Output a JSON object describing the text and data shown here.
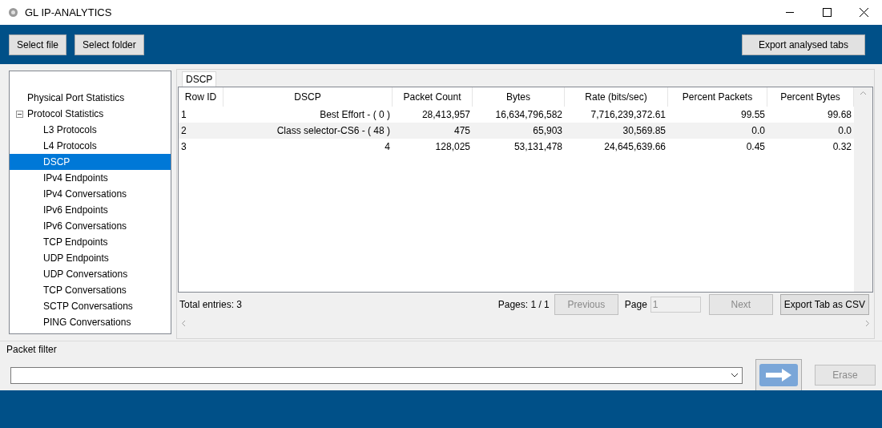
{
  "window": {
    "title": "GL IP-ANALYTICS"
  },
  "toolbar": {
    "left_buttons": [
      "Select file",
      "Select folder"
    ],
    "right_button": "Export analysed tabs"
  },
  "tree": [
    {
      "label": "Physical Port Statistics",
      "selected": false
    },
    {
      "label": "Protocol Statistics",
      "selected": false,
      "expanded": true,
      "children": [
        {
          "label": "L3 Protocols",
          "selected": false
        },
        {
          "label": "L4 Protocols",
          "selected": false
        },
        {
          "label": "DSCP",
          "selected": true
        },
        {
          "label": "IPv4 Endpoints",
          "selected": false
        },
        {
          "label": "IPv4 Conversations",
          "selected": false
        },
        {
          "label": "IPv6 Endpoints",
          "selected": false
        },
        {
          "label": "IPv6 Conversations",
          "selected": false
        },
        {
          "label": "TCP Endpoints",
          "selected": false
        },
        {
          "label": "UDP Endpoints",
          "selected": false
        },
        {
          "label": "UDP Conversations",
          "selected": false
        },
        {
          "label": "TCP Conversations",
          "selected": false
        },
        {
          "label": "SCTP Conversations",
          "selected": false
        },
        {
          "label": "PING Conversations",
          "selected": false
        }
      ]
    }
  ],
  "tabs": [
    {
      "label": "DSCP",
      "selected": true
    }
  ],
  "table": {
    "columns": [
      "Row ID",
      "DSCP",
      "Packet Count",
      "Bytes",
      "Rate (bits/sec)",
      "Percent Packets",
      "Percent Bytes"
    ],
    "rows": [
      [
        "1",
        "Best Effort - ( 0 )",
        "28,413,957",
        "16,634,796,582",
        "7,716,239,372.61",
        "99.55",
        "99.68"
      ],
      [
        "2",
        "Class selector-CS6 - ( 48 )",
        "475",
        "65,903",
        "30,569.85",
        "0.0",
        "0.0"
      ],
      [
        "3",
        "4",
        "128,025",
        "53,131,478",
        "24,645,639.66",
        "0.45",
        "0.32"
      ]
    ]
  },
  "footer": {
    "total": "Total entries: 3",
    "pages": "Pages: 1 / 1",
    "previous": {
      "label": "Previous",
      "disabled": true
    },
    "page_label": "Page",
    "page_value": "1",
    "next": {
      "label": "Next",
      "disabled": true
    },
    "export": "Export Tab as CSV"
  },
  "packet_filter": {
    "label": "Packet filter",
    "erase": {
      "label": "Erase",
      "disabled": true
    }
  }
}
